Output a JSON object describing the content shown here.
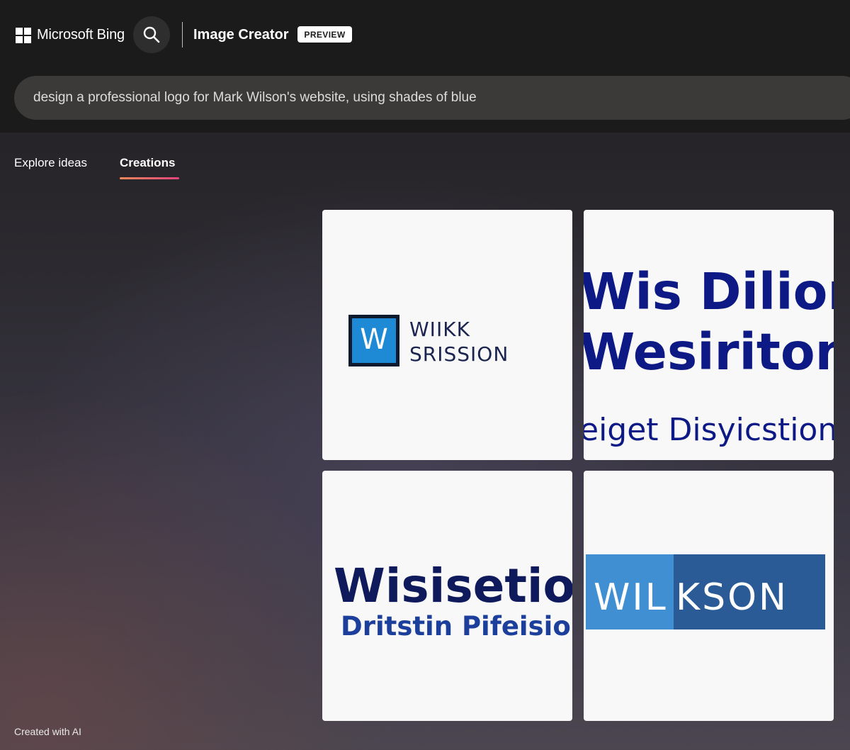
{
  "header": {
    "brand_name": "Microsoft Bing",
    "app_title": "Image Creator",
    "badge": "PREVIEW",
    "search_icon": "search-icon"
  },
  "prompt": {
    "text": "design a professional logo for Mark Wilson's website, using shades of blue"
  },
  "tabs": [
    {
      "label": "Explore ideas",
      "active": false
    },
    {
      "label": "Creations",
      "active": true
    }
  ],
  "results": [
    {
      "logo_mark": "W",
      "lines": [
        "WIIKK",
        "SRISSION"
      ]
    },
    {
      "lines": [
        "Wis Dilion",
        "Wesiriton",
        "eiget Disyicstion"
      ]
    },
    {
      "lines": [
        "Wisisetion",
        "Dritstin Pifeisionu"
      ]
    },
    {
      "lines": [
        "WIL",
        "KSON"
      ]
    }
  ],
  "footer": {
    "note": "Created with AI"
  },
  "colors": {
    "header_bg": "#1c1b1b",
    "prompt_bg": "#3b3a39",
    "navy": "#0d1a86",
    "dark_navy": "#0f1a5c",
    "logo_blue": "#1e8ad6",
    "banner_light": "#3f8fd2",
    "banner_dark": "#2a5b96",
    "tab_underline_start": "#f58a5b",
    "tab_underline_end": "#e3437b"
  }
}
